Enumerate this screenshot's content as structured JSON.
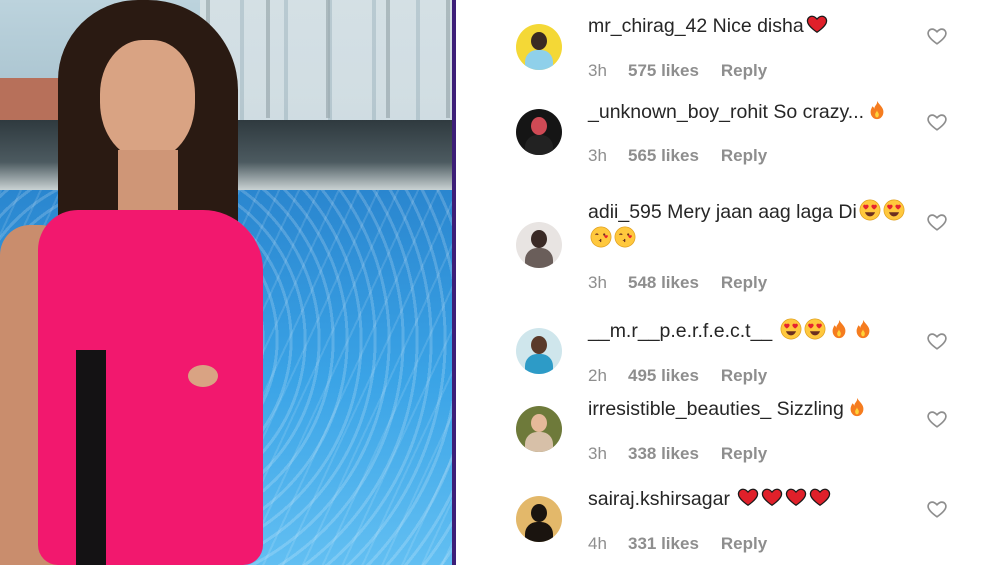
{
  "comments": [
    {
      "username": "mr_chirag_42",
      "text": "Nice disha",
      "emojis": [
        "red-heart"
      ],
      "time": "3h",
      "likes": "575 likes",
      "reply": "Reply",
      "avatar_colors": {
        "bg": "#f4d836",
        "head": "#3a2a22",
        "body": "#8fd0ea"
      }
    },
    {
      "username": "_unknown_boy_rohit",
      "text": "So crazy...",
      "emojis": [
        "fire"
      ],
      "time": "3h",
      "likes": "565 likes",
      "reply": "Reply",
      "avatar_colors": {
        "bg": "#151515",
        "head": "#cf4a55",
        "body": "#222"
      }
    },
    {
      "username": "adii_595",
      "text": "Mery jaan aag laga Di",
      "emojis": [
        "heart-eyes",
        "heart-eyes",
        "kiss-face",
        "kiss-face"
      ],
      "time": "3h",
      "likes": "548 likes",
      "reply": "Reply",
      "avatar_colors": {
        "bg": "#e8e4e2",
        "head": "#3a2a26",
        "body": "#6a5e5a"
      }
    },
    {
      "username": "__m.r__p.e.r.f.e.c.t__",
      "text": "",
      "emojis": [
        "heart-eyes",
        "heart-eyes",
        "fire",
        "fire"
      ],
      "time": "2h",
      "likes": "495 likes",
      "reply": "Reply",
      "avatar_colors": {
        "bg": "#cfe6ec",
        "head": "#5a3a2a",
        "body": "#2d9bc7"
      }
    },
    {
      "username": "irresistible_beauties_",
      "text": "Sizzling",
      "emojis": [
        "fire"
      ],
      "time": "3h",
      "likes": "338 likes",
      "reply": "Reply",
      "avatar_colors": {
        "bg": "#6e7a3a",
        "head": "#e6b99a",
        "body": "#d7c0a8"
      }
    },
    {
      "username": "sairaj.kshirsagar",
      "text": "",
      "emojis": [
        "red-heart",
        "red-heart",
        "red-heart",
        "red-heart"
      ],
      "time": "4h",
      "likes": "331 likes",
      "reply": "Reply",
      "avatar_colors": {
        "bg": "#e3b86a",
        "head": "#1a140f",
        "body": "#1a140f"
      }
    }
  ],
  "colors": {
    "username": "#262626",
    "meta": "#8e8e8e",
    "heart_outline": "#8e8e8e",
    "divider": "#3d1f78"
  }
}
